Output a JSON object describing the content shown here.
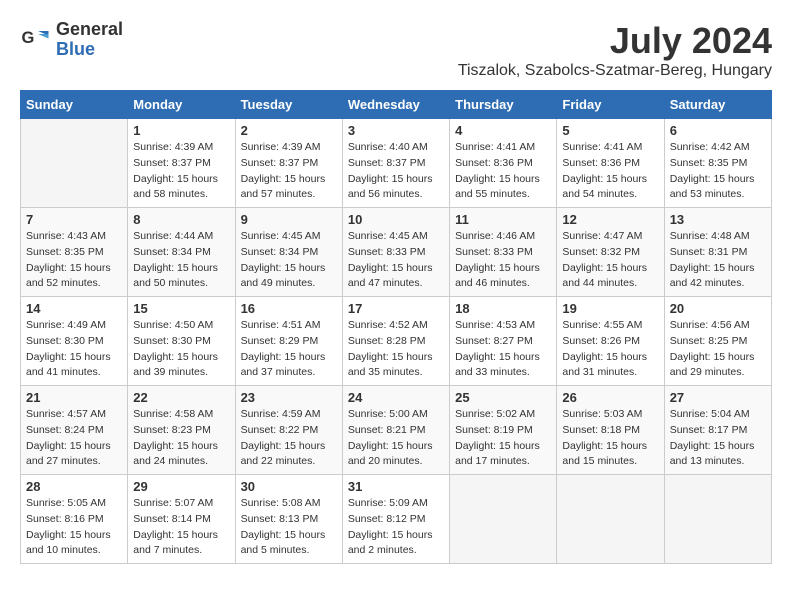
{
  "logo": {
    "general": "General",
    "blue": "Blue"
  },
  "title": {
    "month_year": "July 2024",
    "location": "Tiszalok, Szabolcs-Szatmar-Bereg, Hungary"
  },
  "headers": [
    "Sunday",
    "Monday",
    "Tuesday",
    "Wednesday",
    "Thursday",
    "Friday",
    "Saturday"
  ],
  "weeks": [
    [
      null,
      {
        "day": "1",
        "sunrise": "4:39 AM",
        "sunset": "8:37 PM",
        "daylight": "15 hours and 58 minutes."
      },
      {
        "day": "2",
        "sunrise": "4:39 AM",
        "sunset": "8:37 PM",
        "daylight": "15 hours and 57 minutes."
      },
      {
        "day": "3",
        "sunrise": "4:40 AM",
        "sunset": "8:37 PM",
        "daylight": "15 hours and 56 minutes."
      },
      {
        "day": "4",
        "sunrise": "4:41 AM",
        "sunset": "8:36 PM",
        "daylight": "15 hours and 55 minutes."
      },
      {
        "day": "5",
        "sunrise": "4:41 AM",
        "sunset": "8:36 PM",
        "daylight": "15 hours and 54 minutes."
      },
      {
        "day": "6",
        "sunrise": "4:42 AM",
        "sunset": "8:35 PM",
        "daylight": "15 hours and 53 minutes."
      }
    ],
    [
      {
        "day": "7",
        "sunrise": "4:43 AM",
        "sunset": "8:35 PM",
        "daylight": "15 hours and 52 minutes."
      },
      {
        "day": "8",
        "sunrise": "4:44 AM",
        "sunset": "8:34 PM",
        "daylight": "15 hours and 50 minutes."
      },
      {
        "day": "9",
        "sunrise": "4:45 AM",
        "sunset": "8:34 PM",
        "daylight": "15 hours and 49 minutes."
      },
      {
        "day": "10",
        "sunrise": "4:45 AM",
        "sunset": "8:33 PM",
        "daylight": "15 hours and 47 minutes."
      },
      {
        "day": "11",
        "sunrise": "4:46 AM",
        "sunset": "8:33 PM",
        "daylight": "15 hours and 46 minutes."
      },
      {
        "day": "12",
        "sunrise": "4:47 AM",
        "sunset": "8:32 PM",
        "daylight": "15 hours and 44 minutes."
      },
      {
        "day": "13",
        "sunrise": "4:48 AM",
        "sunset": "8:31 PM",
        "daylight": "15 hours and 42 minutes."
      }
    ],
    [
      {
        "day": "14",
        "sunrise": "4:49 AM",
        "sunset": "8:30 PM",
        "daylight": "15 hours and 41 minutes."
      },
      {
        "day": "15",
        "sunrise": "4:50 AM",
        "sunset": "8:30 PM",
        "daylight": "15 hours and 39 minutes."
      },
      {
        "day": "16",
        "sunrise": "4:51 AM",
        "sunset": "8:29 PM",
        "daylight": "15 hours and 37 minutes."
      },
      {
        "day": "17",
        "sunrise": "4:52 AM",
        "sunset": "8:28 PM",
        "daylight": "15 hours and 35 minutes."
      },
      {
        "day": "18",
        "sunrise": "4:53 AM",
        "sunset": "8:27 PM",
        "daylight": "15 hours and 33 minutes."
      },
      {
        "day": "19",
        "sunrise": "4:55 AM",
        "sunset": "8:26 PM",
        "daylight": "15 hours and 31 minutes."
      },
      {
        "day": "20",
        "sunrise": "4:56 AM",
        "sunset": "8:25 PM",
        "daylight": "15 hours and 29 minutes."
      }
    ],
    [
      {
        "day": "21",
        "sunrise": "4:57 AM",
        "sunset": "8:24 PM",
        "daylight": "15 hours and 27 minutes."
      },
      {
        "day": "22",
        "sunrise": "4:58 AM",
        "sunset": "8:23 PM",
        "daylight": "15 hours and 24 minutes."
      },
      {
        "day": "23",
        "sunrise": "4:59 AM",
        "sunset": "8:22 PM",
        "daylight": "15 hours and 22 minutes."
      },
      {
        "day": "24",
        "sunrise": "5:00 AM",
        "sunset": "8:21 PM",
        "daylight": "15 hours and 20 minutes."
      },
      {
        "day": "25",
        "sunrise": "5:02 AM",
        "sunset": "8:19 PM",
        "daylight": "15 hours and 17 minutes."
      },
      {
        "day": "26",
        "sunrise": "5:03 AM",
        "sunset": "8:18 PM",
        "daylight": "15 hours and 15 minutes."
      },
      {
        "day": "27",
        "sunrise": "5:04 AM",
        "sunset": "8:17 PM",
        "daylight": "15 hours and 13 minutes."
      }
    ],
    [
      {
        "day": "28",
        "sunrise": "5:05 AM",
        "sunset": "8:16 PM",
        "daylight": "15 hours and 10 minutes."
      },
      {
        "day": "29",
        "sunrise": "5:07 AM",
        "sunset": "8:14 PM",
        "daylight": "15 hours and 7 minutes."
      },
      {
        "day": "30",
        "sunrise": "5:08 AM",
        "sunset": "8:13 PM",
        "daylight": "15 hours and 5 minutes."
      },
      {
        "day": "31",
        "sunrise": "5:09 AM",
        "sunset": "8:12 PM",
        "daylight": "15 hours and 2 minutes."
      },
      null,
      null,
      null
    ]
  ]
}
